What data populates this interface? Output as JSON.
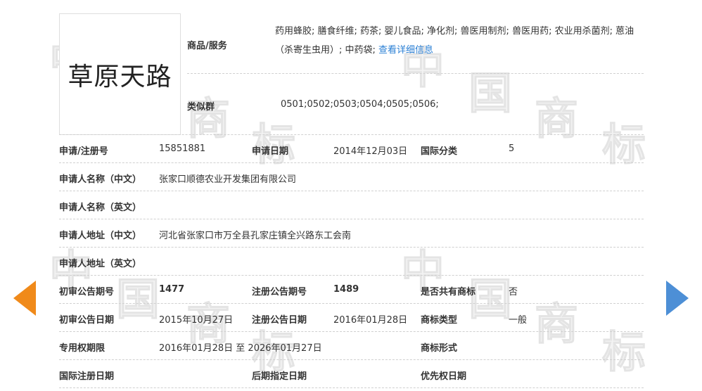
{
  "trademark": {
    "logo_text": "草原天路",
    "goods_label": "商品/服务",
    "goods_text": "药用蜂胶; 膳食纤维; 药茶; 婴儿食品; 净化剂; 兽医用制剂; 兽医用药; 农业用杀菌剂; 蒽油（杀寄生虫用）; 中药袋; ",
    "goods_link": "查看详细信息",
    "similar_group_label": "类似群",
    "similar_group_value": "0501;0502;0503;0504;0505;0506;"
  },
  "details": {
    "app_no_label": "申请/注册号",
    "app_no": "15851881",
    "app_date_label": "申请日期",
    "app_date": "2014年12月03日",
    "intl_class_label": "国际分类",
    "intl_class": "5",
    "applicant_cn_label": "申请人名称（中文）",
    "applicant_cn": "张家口顺德农业开发集团有限公司",
    "applicant_en_label": "申请人名称（英文）",
    "applicant_en": "",
    "address_cn_label": "申请人地址（中文）",
    "address_cn": "河北省张家口市万全县孔家庄镇全兴路东工会南",
    "address_en_label": "申请人地址（英文）",
    "address_en": "",
    "prelim_no_label": "初审公告期号",
    "prelim_no": "1477",
    "reg_no_label": "注册公告期号",
    "reg_no": "1489",
    "shared_label": "是否共有商标",
    "shared": "否",
    "prelim_date_label": "初审公告日期",
    "prelim_date": "2015年10月27日",
    "reg_date_label": "注册公告日期",
    "reg_date": "2016年01月28日",
    "tm_type_label": "商标类型",
    "tm_type": "一般",
    "term_label": "专用权期限",
    "term": "2016年01月28日 至 2026年01月27日",
    "tm_form_label": "商标形式",
    "tm_form": "",
    "intl_reg_date_label": "国际注册日期",
    "intl_reg_date": "",
    "later_date_label": "后期指定日期",
    "later_date": "",
    "priority_date_label": "优先权日期",
    "priority_date": ""
  },
  "watermark": [
    "中",
    "国",
    "商",
    "标"
  ],
  "nav": {
    "prev_icon": "arrow-left-icon",
    "next_icon": "arrow-right-icon"
  },
  "colors": {
    "prev_arrow": "#f08a1a",
    "next_arrow": "#4d8fd6",
    "link": "#2a7fd4"
  }
}
